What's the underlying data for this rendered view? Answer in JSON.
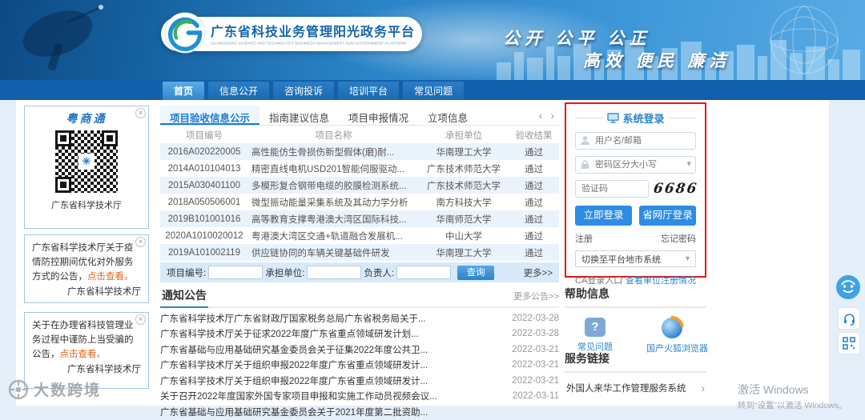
{
  "header": {
    "title": "广东省科技业务管理阳光政务平台",
    "subtitle": "GUANGDONG SCIENCE AND TECHNOLOGY BUSINESS MANAGEMENT SUN GOVERNMENT PLATFORM",
    "slogan_line1": "公开 公平 公正",
    "slogan_line2": "高效 便民 廉洁"
  },
  "nav": {
    "items": [
      {
        "label": "首页"
      },
      {
        "label": "信息公开"
      },
      {
        "label": "咨询投诉"
      },
      {
        "label": "培训平台"
      },
      {
        "label": "常见问题"
      }
    ]
  },
  "sidebar": {
    "qr_panel": {
      "title": "粤商通",
      "caption": "广东省科学技术厅"
    },
    "notice1": {
      "text": "广东省科学技术厅关于疫情防控期间优化对外服务方式的公告，",
      "link": "点击查看。",
      "signature": "广东省科学技术厅"
    },
    "notice2": {
      "text": "关于在办理省科技管理业务过程中谨防上当受骗的公告，",
      "link": "点击查看。",
      "signature": "广东省科学技术厅"
    }
  },
  "main": {
    "tabs": [
      {
        "label": "项目验收信息公示"
      },
      {
        "label": "指南建议信息"
      },
      {
        "label": "项目申报情况"
      },
      {
        "label": "立项信息"
      }
    ],
    "table": {
      "headers": [
        "项目编号",
        "项目名称",
        "承担单位",
        "验收结果"
      ],
      "rows": [
        {
          "code": "2016A020220005",
          "name": "高性能仿生骨损伤新型假体(磨)耐...",
          "unit": "华南理工大学",
          "result": "通过"
        },
        {
          "code": "2014A010104013",
          "name": "精密直线电机USD201智能伺服驱动...",
          "unit": "广东技术师范大学",
          "result": "通过"
        },
        {
          "code": "2015A030401100",
          "name": "多模形复合钢带电缆的胶膜检测系统...",
          "unit": "广东技术师范大学",
          "result": "通过"
        },
        {
          "code": "2018A050506001",
          "name": "微型振动能量采集系统及其动力学分析",
          "unit": "南方科技大学",
          "result": "通过"
        },
        {
          "code": "2019B101001016",
          "name": "高等教育支撑粤港澳大湾区国际科技...",
          "unit": "华南师范大学",
          "result": "通过"
        },
        {
          "code": "2020A1010020012",
          "name": "粤港澳大湾区交通+轨道融合发展机...",
          "unit": "中山大学",
          "result": "通过"
        },
        {
          "code": "2019A101002119",
          "name": "供应链协同的车辆关键基础件研发",
          "unit": "华南理工大学",
          "result": "通过"
        }
      ]
    },
    "search": {
      "label_code": "项目编号:",
      "label_unit": "承担单位:",
      "label_leader": "负责人:",
      "query_button": "查询",
      "more_link": "更多>>"
    },
    "notices": {
      "title": "通知公告",
      "more": "更多公告>>",
      "items": [
        {
          "title": "广东省科学技术厅广东省财政厅国家税务总局广东省税务局关于...",
          "date": "2022-03-28"
        },
        {
          "title": "广东省科学技术厅关于征求2022年度广东省重点领域研发计划...",
          "date": "2022-03-28"
        },
        {
          "title": "广东省基础与应用基础研究基金委员会关于征集2022年度公共卫...",
          "date": "2022-03-21"
        },
        {
          "title": "广东省科学技术厅关于组织申报2022年度广东省重点领域研发计...",
          "date": "2022-03-21"
        },
        {
          "title": "广东省科学技术厅关于组织申报2022年度广东省重点领域研发计...",
          "date": "2022-03-21"
        },
        {
          "title": "关于召开2022年度国家外国专家项目申报和实施工作动员视频会议...",
          "date": "2022-03-11"
        },
        {
          "title": "广东省基础与应用基础研究基金委员会关于2021年度第二批资助...",
          "date": ""
        }
      ]
    }
  },
  "login": {
    "title": "系统登录",
    "username_placeholder": "用户名/邮箱",
    "password_placeholder": "密码区分大小写",
    "captcha_placeholder": "验证码",
    "captcha_value": "6686",
    "login_button": "立即登录",
    "gov_login_button": "省网厅登录",
    "register_link": "注册",
    "forgot_link": "忘记密码",
    "switch_select": "切换至平台地市系统",
    "ca_entry": "CA登录入口",
    "unit_check": "查看单位注册情况"
  },
  "help": {
    "title": "帮助信息",
    "item1": "常见问题",
    "item2": "国产火狐浏览器"
  },
  "links": {
    "title": "服务链接",
    "item": "外国人来华工作管理服务系统"
  },
  "overlay": {
    "watermark": "大数跨境",
    "win_activate": "激活 Windows",
    "win_hint": "转到“设置”以激活 Windows。"
  },
  "icons": {
    "close": "×",
    "caret": "▾",
    "chevron_right": "›",
    "pager_prev": "‹",
    "pager_next": "›",
    "qr_center": "✳",
    "question": "?"
  }
}
